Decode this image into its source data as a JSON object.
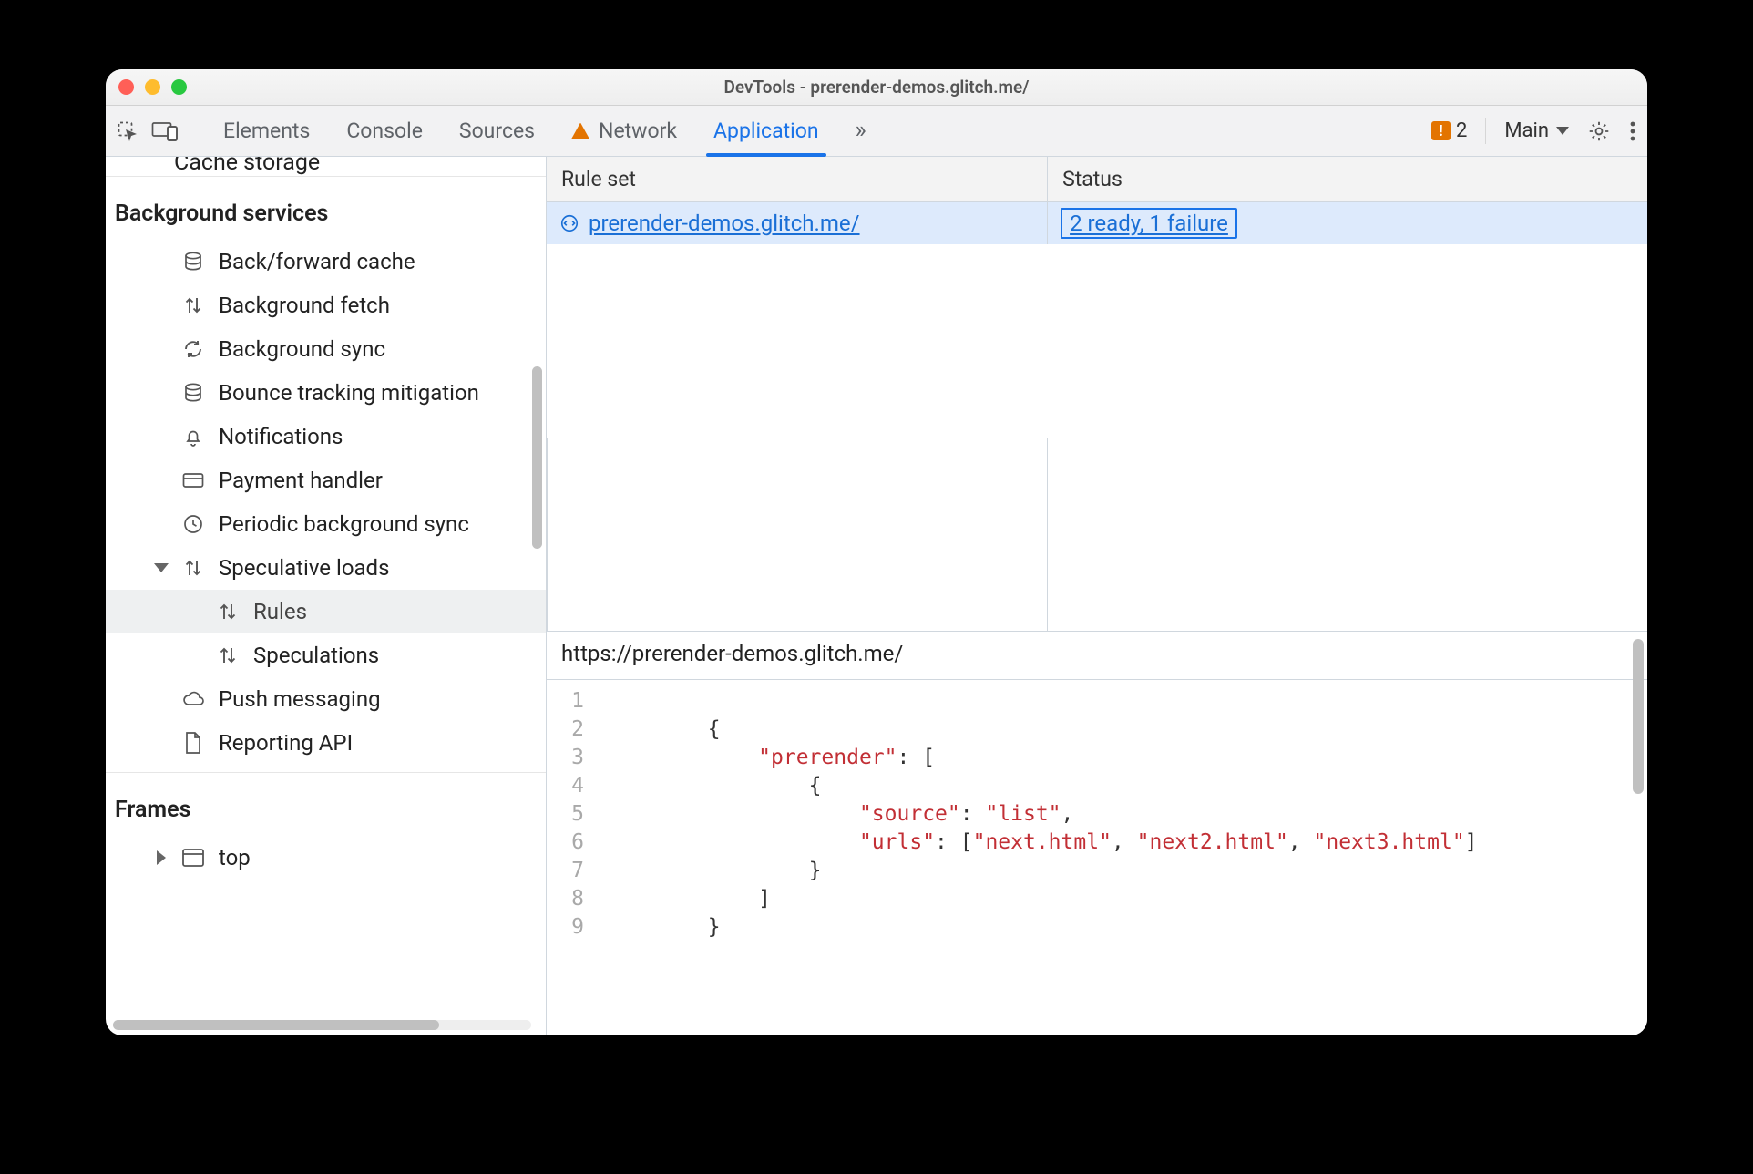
{
  "window": {
    "title": "DevTools - prerender-demos.glitch.me/"
  },
  "toolbar": {
    "tabs": [
      "Elements",
      "Console",
      "Sources",
      "Network",
      "Application"
    ],
    "active_tab": "Application",
    "warn_tab": "Network",
    "more_tabs_glyph": "»",
    "error_count": "2",
    "context_label": "Main",
    "inspect_icon": "inspect-icon",
    "device_icon": "device-toolbar-icon",
    "settings_icon": "settings-icon",
    "more_icon": "kebab-icon"
  },
  "sidebar": {
    "clipped_item_label": "Cache storage",
    "sections": {
      "bg": {
        "title": "Background services",
        "items": [
          {
            "label": "Back/forward cache",
            "icon": "database-icon"
          },
          {
            "label": "Background fetch",
            "icon": "swap-vert-icon"
          },
          {
            "label": "Background sync",
            "icon": "sync-icon"
          },
          {
            "label": "Bounce tracking mitigation",
            "icon": "database-icon"
          },
          {
            "label": "Notifications",
            "icon": "bell-icon"
          },
          {
            "label": "Payment handler",
            "icon": "card-icon"
          },
          {
            "label": "Periodic background sync",
            "icon": "clock-icon"
          },
          {
            "label": "Speculative loads",
            "icon": "swap-vert-icon",
            "expanded": true,
            "children": [
              {
                "label": "Rules",
                "icon": "swap-vert-icon",
                "selected": true
              },
              {
                "label": "Speculations",
                "icon": "swap-vert-icon"
              }
            ]
          },
          {
            "label": "Push messaging",
            "icon": "cloud-icon"
          },
          {
            "label": "Reporting API",
            "icon": "file-icon"
          }
        ]
      },
      "frames": {
        "title": "Frames",
        "items": [
          {
            "label": "top",
            "icon": "frame-icon",
            "expandable": true
          }
        ]
      }
    }
  },
  "rules_table": {
    "columns": [
      "Rule set",
      "Status"
    ],
    "rows": [
      {
        "ruleset_label": " prerender-demos.glitch.me/",
        "status_text": "2 ready,  1 failure"
      }
    ]
  },
  "detail": {
    "origin": "https://prerender-demos.glitch.me/",
    "code_lines": [
      {
        "n": "1",
        "html": ""
      },
      {
        "n": "2",
        "html": "        <span class='p'>{</span>"
      },
      {
        "n": "3",
        "html": "            <span class='str'>\"prerender\"</span><span class='p'>: [</span>"
      },
      {
        "n": "4",
        "html": "                <span class='p'>{</span>"
      },
      {
        "n": "5",
        "html": "                    <span class='str'>\"source\"</span><span class='p'>: </span><span class='str'>\"list\"</span><span class='p'>,</span>"
      },
      {
        "n": "6",
        "html": "                    <span class='str'>\"urls\"</span><span class='p'>: [</span><span class='str'>\"next.html\"</span><span class='p'>, </span><span class='str'>\"next2.html\"</span><span class='p'>, </span><span class='str'>\"next3.html\"</span><span class='p'>]</span>"
      },
      {
        "n": "7",
        "html": "                <span class='p'>}</span>"
      },
      {
        "n": "8",
        "html": "            <span class='p'>]</span>"
      },
      {
        "n": "9",
        "html": "        <span class='p'>}</span>"
      }
    ]
  }
}
